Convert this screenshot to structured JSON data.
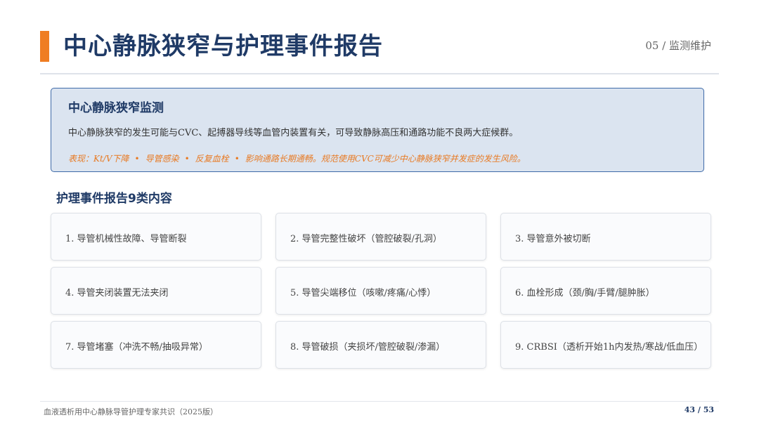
{
  "header": {
    "title": "中心静脉狭窄与护理事件报告",
    "section": "05 / 监测维护"
  },
  "monitor_box": {
    "title": "中心静脉狭窄监测",
    "description": "中心静脉狭窄的发生可能与CVC、起搏器导线等血管内装置有关，可导致静脉高压和通路功能不良两大症候群。",
    "note_items": [
      "表现：Kt/V下降",
      "导管感染",
      "反复血栓",
      "影响通路长期通畅。规范使用CVC可减少中心静脉狭窄并发症的发生风险。"
    ],
    "note_separator": "•"
  },
  "report": {
    "title": "护理事件报告9类内容",
    "items": [
      "1. 导管机械性故障、导管断裂",
      "2. 导管完整性破坏（管腔破裂/孔洞）",
      "3. 导管意外被切断",
      "4. 导管夹闭装置无法夹闭",
      "5. 导管尖端移位（咳嗽/疼痛/心悸）",
      "6. 血栓形成（颈/胸/手臂/腿肿胀）",
      "7. 导管堵塞（冲洗不畅/抽吸异常）",
      "8. 导管破损（夹损坏/管腔破裂/渗漏）",
      "9. CRBSI（透析开始1h内发热/寒战/低血压）"
    ]
  },
  "footer": {
    "source": "血液透析用中心静脉导管护理专家共识（2025版）",
    "page": "43 / 53"
  },
  "colors": {
    "accent": "#ef7d22",
    "title_navy": "#1f3a66",
    "box_fill": "#dbe4f0",
    "box_border": "#3e6aa8",
    "note_orange": "#e87a23"
  }
}
